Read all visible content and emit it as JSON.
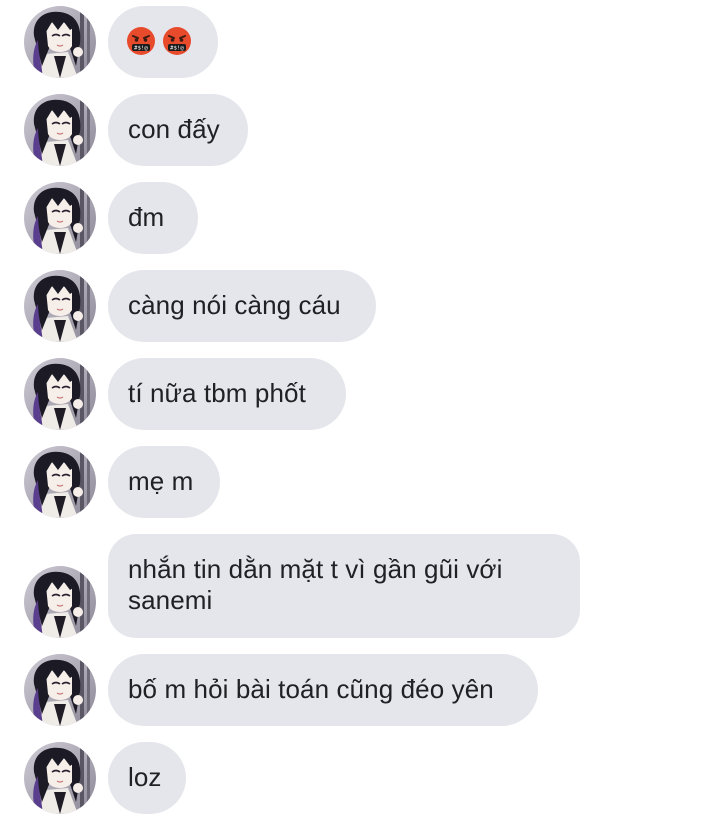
{
  "conversation": {
    "messages": [
      {
        "id": "m1",
        "kind": "emoji",
        "emoji": [
          "🤬",
          "🤬"
        ],
        "emoji_icon": "face-with-symbols-on-mouth-icon"
      },
      {
        "id": "m2",
        "kind": "text",
        "text": "con đấy"
      },
      {
        "id": "m3",
        "kind": "text",
        "text": "đm"
      },
      {
        "id": "m4",
        "kind": "text",
        "text": "càng nói càng cáu"
      },
      {
        "id": "m5",
        "kind": "text",
        "text": "tí nữa tbm phốt"
      },
      {
        "id": "m6",
        "kind": "text",
        "text": "mẹ m"
      },
      {
        "id": "m7",
        "kind": "text",
        "text": "nhắn tin dằn mặt t vì gần gũi với sanemi"
      },
      {
        "id": "m8",
        "kind": "text",
        "text": "bố m hỏi bài toán cũng đéo yên"
      },
      {
        "id": "m9",
        "kind": "text",
        "text": "loz"
      }
    ],
    "avatar_icon": "contact-avatar-icon"
  },
  "colors": {
    "bubble_background": "#e4e6eb",
    "text": "#202124",
    "page_background": "#ffffff",
    "emoji_face": "#e84a2c"
  }
}
